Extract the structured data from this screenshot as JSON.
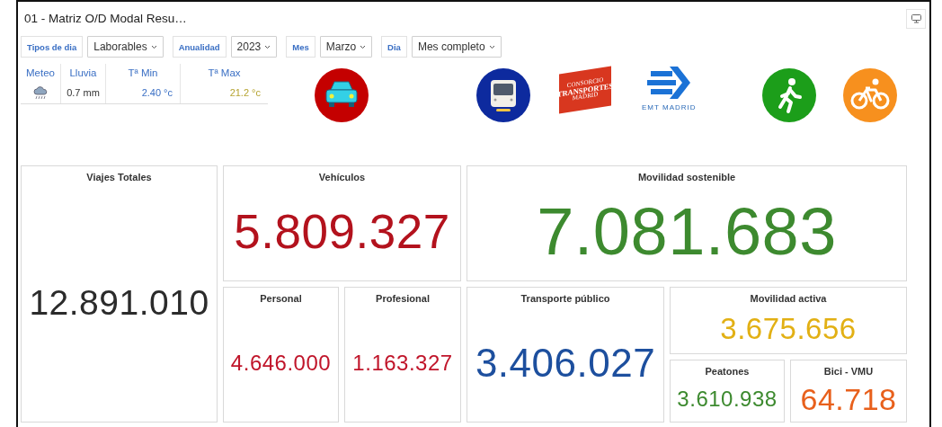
{
  "title": "01 - Matriz O/D Modal Resu…",
  "filters": [
    {
      "label": "Tipos de dia",
      "value": "Laborables"
    },
    {
      "label": "Anualidad",
      "value": "2023"
    },
    {
      "label": "Mes",
      "value": "Marzo"
    },
    {
      "label": "Dia",
      "value": "Mes completo"
    }
  ],
  "weather": {
    "columns": [
      "Meteo",
      "Lluvia",
      "Tª Min",
      "Tª Max"
    ],
    "rain": "0.7 mm",
    "min_temp": "2.40 °c",
    "max_temp": "21.2 °c"
  },
  "logos": [
    {
      "kind": "car"
    },
    {
      "kind": "train"
    },
    {
      "kind": "crtm",
      "lines": [
        "CONSORCIO",
        "TRANSPORTES",
        "MADRID"
      ]
    },
    {
      "kind": "emt",
      "text": "EMT MADRID"
    },
    {
      "kind": "walk"
    },
    {
      "kind": "bike"
    }
  ],
  "cards": [
    {
      "title": "Viajes Totales",
      "value": "12.891.010",
      "color": "#2b2b2b"
    },
    {
      "title": "Vehículos",
      "value": "5.809.327",
      "color": "#b3121d"
    },
    {
      "title": "Movilidad sostenible",
      "value": "7.081.683",
      "color": "#3d8a2f"
    },
    {
      "title": "Personal",
      "value": "4.646.000",
      "color": "#c0152a"
    },
    {
      "title": "Profesional",
      "value": "1.163.327",
      "color": "#c0152a"
    },
    {
      "title": "Transporte público",
      "value": "3.406.027",
      "color": "#1d4f9e"
    },
    {
      "title": "Movilidad activa",
      "value": "3.675.656",
      "color": "#e2b014"
    },
    {
      "title": "Peatones",
      "value": "3.610.938",
      "color": "#3d8a2f"
    },
    {
      "title": "Bici - VMU",
      "value": "64.718",
      "color": "#e8601c"
    }
  ]
}
